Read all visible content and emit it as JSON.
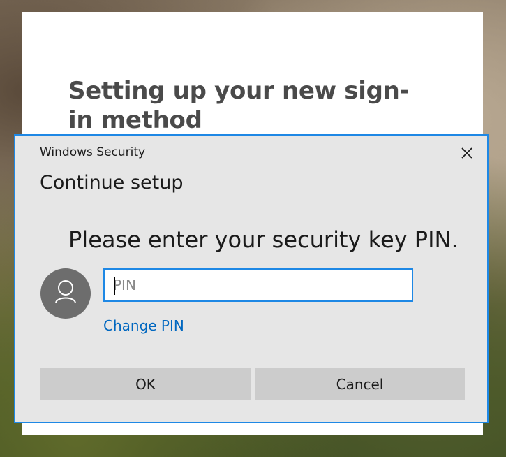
{
  "background_window": {
    "title": "Setting up your new sign-in method"
  },
  "dialog": {
    "caption": "Windows Security",
    "heading": "Continue setup",
    "prompt": "Please enter your security key PIN.",
    "pin_input": {
      "value": "",
      "placeholder": "PIN"
    },
    "change_pin_label": "Change PIN",
    "ok_label": "OK",
    "cancel_label": "Cancel",
    "icons": {
      "close": "close-icon",
      "avatar": "user-icon"
    },
    "accent_color": "#1e88e5",
    "link_color": "#0067c0"
  }
}
